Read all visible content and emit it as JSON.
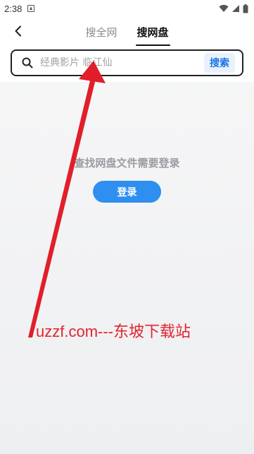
{
  "status_bar": {
    "time": "2:38",
    "icons": [
      "notification-icon",
      "wifi-icon",
      "signal-icon",
      "battery-icon"
    ]
  },
  "header": {
    "back_icon": "chevron-left-icon",
    "tabs": [
      {
        "label": "搜全网",
        "active": false
      },
      {
        "label": "搜网盘",
        "active": true
      }
    ]
  },
  "search": {
    "icon": "search-icon",
    "placeholder": "经典影片 临江仙",
    "value": "",
    "button_label": "搜索"
  },
  "main": {
    "prompt": "查找网盘文件需要登录",
    "login_label": "登录"
  },
  "watermark": {
    "text": "uzzf.com---东坡下载站"
  },
  "colors": {
    "accent": "#2e8ff0",
    "search_button_text": "#1a73e8",
    "watermark": "#e2242d"
  }
}
